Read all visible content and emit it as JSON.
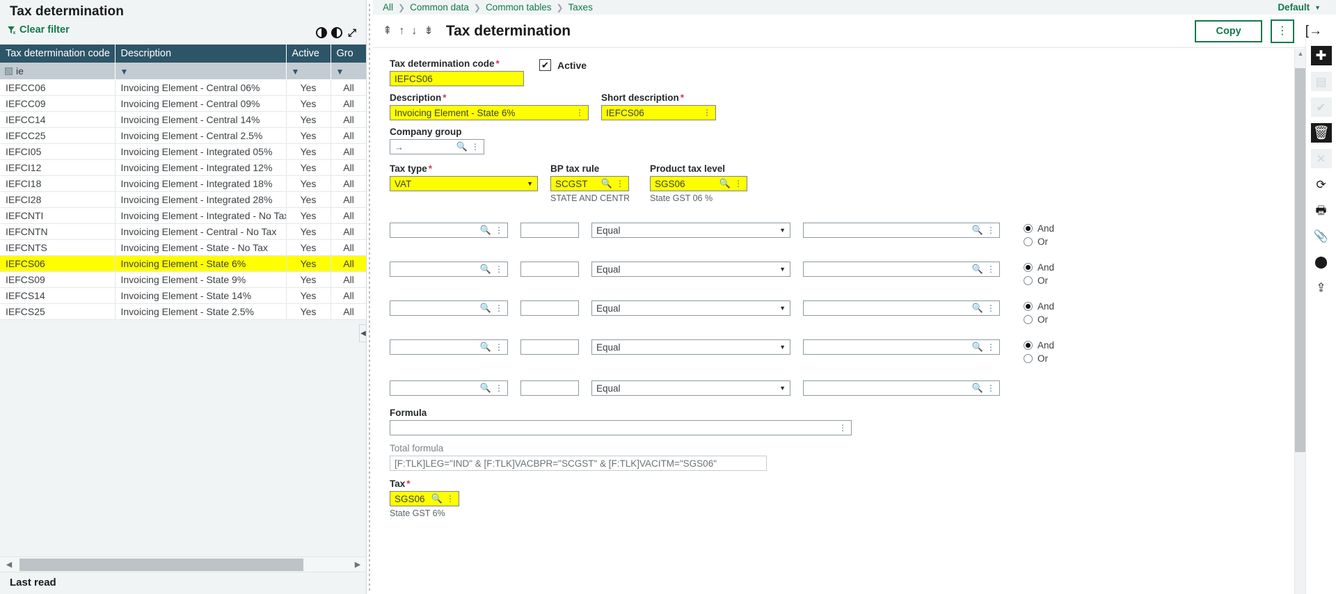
{
  "left_panel": {
    "title": "Tax determination",
    "clear_filter_label": "Clear filter",
    "columns": [
      "Tax determination code",
      "Description",
      "Active",
      "Gro"
    ],
    "filter_row": {
      "code_filter": "ie",
      "desc_filter": "",
      "active_filter": "",
      "group_filter": ""
    },
    "rows": [
      {
        "code": "IEFCC06",
        "description": "Invoicing Element - Central 06%",
        "active": "Yes",
        "group": "All",
        "selected": false
      },
      {
        "code": "IEFCC09",
        "description": "Invoicing Element - Central 09%",
        "active": "Yes",
        "group": "All",
        "selected": false
      },
      {
        "code": "IEFCC14",
        "description": "Invoicing Element - Central 14%",
        "active": "Yes",
        "group": "All",
        "selected": false
      },
      {
        "code": "IEFCC25",
        "description": "Invoicing Element - Central 2.5%",
        "active": "Yes",
        "group": "All",
        "selected": false
      },
      {
        "code": "IEFCI05",
        "description": "Invoicing Element - Integrated 05%",
        "active": "Yes",
        "group": "All",
        "selected": false
      },
      {
        "code": "IEFCI12",
        "description": "Invoicing Element - Integrated 12%",
        "active": "Yes",
        "group": "All",
        "selected": false
      },
      {
        "code": "IEFCI18",
        "description": "Invoicing Element - Integrated 18%",
        "active": "Yes",
        "group": "All",
        "selected": false
      },
      {
        "code": "IEFCI28",
        "description": "Invoicing Element - Integrated 28%",
        "active": "Yes",
        "group": "All",
        "selected": false
      },
      {
        "code": "IEFCNTI",
        "description": "Invoicing Element - Integrated - No Tax",
        "active": "Yes",
        "group": "All",
        "selected": false
      },
      {
        "code": "IEFCNTN",
        "description": "Invoicing Element - Central - No Tax",
        "active": "Yes",
        "group": "All",
        "selected": false
      },
      {
        "code": "IEFCNTS",
        "description": "Invoicing Element - State - No Tax",
        "active": "Yes",
        "group": "All",
        "selected": false
      },
      {
        "code": "IEFCS06",
        "description": "Invoicing Element - State 6%",
        "active": "Yes",
        "group": "All",
        "selected": true
      },
      {
        "code": "IEFCS09",
        "description": "Invoicing Element - State 9%",
        "active": "Yes",
        "group": "All",
        "selected": false
      },
      {
        "code": "IEFCS14",
        "description": "Invoicing Element - State 14%",
        "active": "Yes",
        "group": "All",
        "selected": false
      },
      {
        "code": "IEFCS25",
        "description": "Invoicing Element - State 2.5%",
        "active": "Yes",
        "group": "All",
        "selected": false
      }
    ],
    "status_label": "Last read"
  },
  "header": {
    "breadcrumb": [
      "All",
      "Common data",
      "Common tables",
      "Taxes"
    ],
    "view_selector": "Default",
    "page_title": "Tax determination",
    "copy_label": "Copy",
    "kebab_label": "⋮",
    "exit_label": "[→"
  },
  "form": {
    "tax_determination_code": {
      "label": "Tax determination code",
      "value": "IEFCS06",
      "required": true
    },
    "active": {
      "label": "Active",
      "checked": true
    },
    "description": {
      "label": "Description",
      "value": "Invoicing Element - State 6%",
      "required": true
    },
    "short_description": {
      "label": "Short description",
      "value": "IEFCS06",
      "required": true
    },
    "company_group": {
      "label": "Company group",
      "value": "",
      "required": false
    },
    "tax_type": {
      "label": "Tax type",
      "value": "VAT",
      "required": true
    },
    "bp_tax_rule": {
      "label": "BP tax rule",
      "value": "SCGST",
      "note": "STATE AND CENTRA...",
      "required": false
    },
    "product_tax_level": {
      "label": "Product tax level",
      "value": "SGS06",
      "note": "State GST 06 %",
      "required": false
    },
    "conditions": [
      {
        "field": "",
        "value2": "",
        "operator": "Equal",
        "value3": "",
        "logic": "And",
        "logic_options": [
          "And",
          "Or"
        ],
        "has_logic": true
      },
      {
        "field": "",
        "value2": "",
        "operator": "Equal",
        "value3": "",
        "logic": "And",
        "logic_options": [
          "And",
          "Or"
        ],
        "has_logic": true
      },
      {
        "field": "",
        "value2": "",
        "operator": "Equal",
        "value3": "",
        "logic": "And",
        "logic_options": [
          "And",
          "Or"
        ],
        "has_logic": true
      },
      {
        "field": "",
        "value2": "",
        "operator": "Equal",
        "value3": "",
        "logic": "And",
        "logic_options": [
          "And",
          "Or"
        ],
        "has_logic": true
      },
      {
        "field": "",
        "value2": "",
        "operator": "Equal",
        "value3": "",
        "logic": "",
        "logic_options": [],
        "has_logic": false
      }
    ],
    "formula": {
      "label": "Formula",
      "value": ""
    },
    "total_formula": {
      "label": "Total formula",
      "value": "[F:TLK]LEG=\"IND\" & [F:TLK]VACBPR=\"SCGST\" & [F:TLK]VACITM=\"SGS06\""
    },
    "tax": {
      "label": "Tax",
      "value": "SGS06",
      "note": "State GST 6%",
      "required": true
    }
  },
  "right_toolbar": [
    {
      "name": "new-icon",
      "glyph": "✚",
      "style": "dark"
    },
    {
      "name": "save-icon",
      "glyph": "▤",
      "style": "disabled"
    },
    {
      "name": "validate-icon",
      "glyph": "✔",
      "style": "disabled"
    },
    {
      "name": "delete-icon",
      "glyph": "🗑",
      "style": "dark"
    },
    {
      "name": "cancel-icon",
      "glyph": "✕",
      "style": "disabled"
    },
    {
      "name": "refresh-icon",
      "glyph": "⟳",
      "style": "plain"
    },
    {
      "name": "print-icon",
      "glyph": "🖶",
      "style": "plain"
    },
    {
      "name": "attach-icon",
      "glyph": "📎",
      "style": "plain"
    },
    {
      "name": "comment-icon",
      "glyph": "⬤",
      "style": "plain"
    },
    {
      "name": "export-icon",
      "glyph": "⇪",
      "style": "plain"
    }
  ],
  "colors": {
    "accent_green": "#12794a",
    "header_blue": "#2d5568",
    "highlight_yellow": "#ffff00",
    "required_red": "#d6365a"
  }
}
